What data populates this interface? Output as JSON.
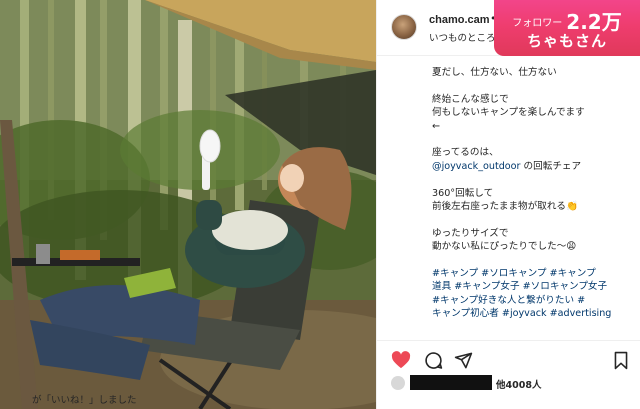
{
  "post": {
    "username": "chamo.cam",
    "separator": "•",
    "location": "いつものところ"
  },
  "badge": {
    "label": "フォロワー",
    "count": "2.2万",
    "name": "ちゃもさん",
    "color": "#ef3d6f"
  },
  "caption": {
    "line1": "夏だし、仕方ない、仕方ない",
    "line2": "終始こんな感じで",
    "line3": "何もしないキャンプを楽しんでます",
    "line4": "←",
    "line5": "座ってるのは、",
    "mention": "@joyvack_outdoor",
    "line6_rest": " の回転チェア",
    "line7": "360°回転して",
    "line8": "前後左右座ったまま物が取れる👏",
    "line9": "ゆったりサイズで",
    "line10": "動かない私にぴったりでした〜😩",
    "tags1": "#キャンプ #ソロキャンプ #キャンプ",
    "tags2": "道具 #キャンプ女子 #ソロキャンプ女子",
    "tags3": "#キャンプ好きな人と繋がりたい #",
    "tags4": "キャンプ初心者 #joyvack #advertising"
  },
  "actions": {
    "like_icon": "heart-icon",
    "comment_icon": "comment-icon",
    "share_icon": "share-icon",
    "save_icon": "bookmark-icon",
    "liked_color": "#ed4956"
  },
  "likes": {
    "others": "他4008人",
    "suffix": "が「いいね！」しました"
  }
}
